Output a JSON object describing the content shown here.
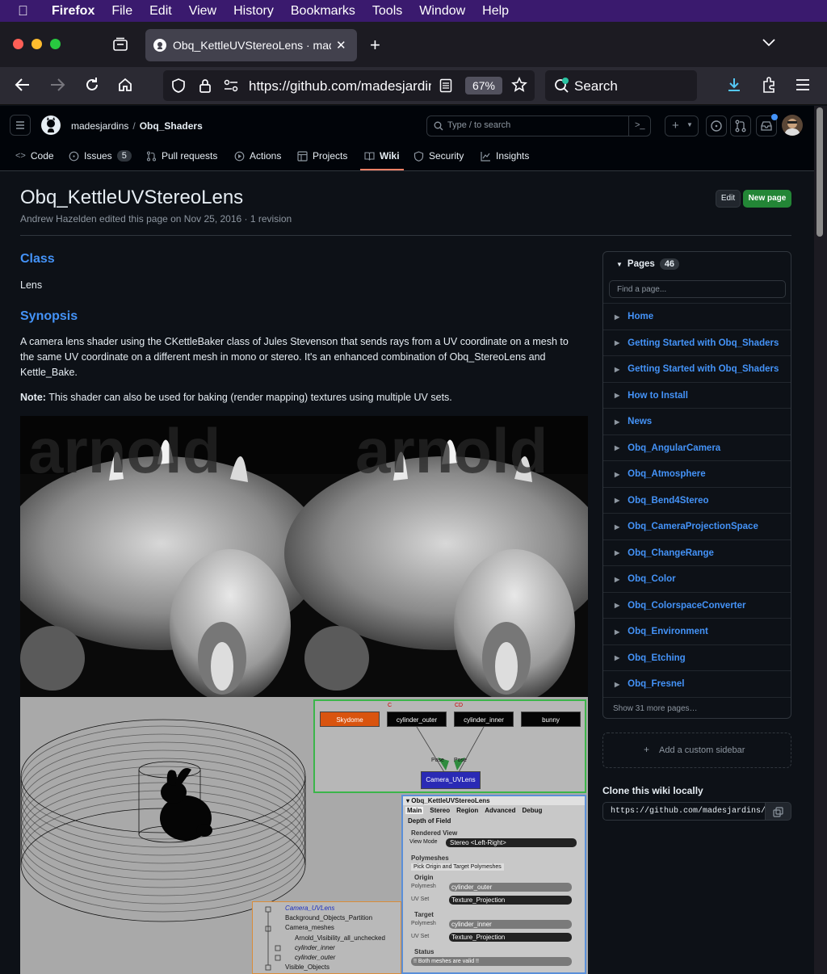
{
  "menubar": {
    "app": "Firefox",
    "items": [
      "File",
      "Edit",
      "View",
      "History",
      "Bookmarks",
      "Tools",
      "Window",
      "Help"
    ]
  },
  "browser": {
    "tab_title": "Obq_KettleUVStereoLens · madesjardins/Obq_Shaders Wiki",
    "url": "https://github.com/madesjardins/Obq_Shaders/wiki/Obq_KettleUVStereoLens",
    "zoom": "67%",
    "search_label": "Search"
  },
  "github": {
    "owner": "madesjardins",
    "sep": "/",
    "repo": "Obq_Shaders",
    "search_placeholder": "Type / to search",
    "tabs": [
      {
        "label": "Code",
        "icon": "code-icon"
      },
      {
        "label": "Issues",
        "count": "5",
        "icon": "issue-icon"
      },
      {
        "label": "Pull requests",
        "icon": "pull-request-icon"
      },
      {
        "label": "Actions",
        "icon": "play-icon"
      },
      {
        "label": "Projects",
        "icon": "table-icon"
      },
      {
        "label": "Wiki",
        "icon": "book-icon",
        "active": true
      },
      {
        "label": "Security",
        "icon": "shield-icon"
      },
      {
        "label": "Insights",
        "icon": "graph-icon"
      }
    ],
    "accent": "#4493f8",
    "active_underline": "#f78166"
  },
  "page": {
    "title": "Obq_KettleUVStereoLens",
    "meta": "Andrew Hazelden edited this page on Nov 25, 2016 · 1 revision",
    "edit_label": "Edit",
    "new_page_label": "New page",
    "class_heading": "Class",
    "class_value": "Lens",
    "synopsis_heading": "Synopsis",
    "synopsis": "A camera lens shader using the CKettleBaker class of Jules Stevenson that sends rays from a UV coordinate on a mesh to the same UV coordinate on a different mesh in mono or stereo. It's an enhanced combination of Obq_StereoLens and Kettle_Bake.",
    "note_label": "Note:",
    "note": " This shader can also be used for baking (render mapping) textures using multiple UV sets."
  },
  "sidebar": {
    "pages_label": "Pages",
    "pages_count": "46",
    "find_placeholder": "Find a page...",
    "items": [
      "Home",
      "Getting Started with Obq_Shaders",
      "Getting Started with Obq_Shaders",
      "How to Install",
      "News",
      "Obq_AngularCamera",
      "Obq_Atmosphere",
      "Obq_Bend4Stereo",
      "Obq_CameraProjectionSpace",
      "Obq_ChangeRange",
      "Obq_Color",
      "Obq_ColorspaceConverter",
      "Obq_Environment",
      "Obq_Etching",
      "Obq_Fresnel"
    ],
    "show_more": "Show 31 more pages…",
    "add_sidebar": "Add a custom sidebar",
    "clone_heading": "Clone this wiki locally",
    "clone_url": "https://github.com/madesjardins/Obq_Shaders.wiki.git"
  },
  "figure": {
    "render_watermark": "arnold",
    "nodes": {
      "skydome": "Skydome",
      "cyl_outer": "cylinder_outer",
      "cyl_inner": "cylinder_inner",
      "bunny": "bunny",
      "camera": "Camera_UVLens",
      "pose1": "Pose",
      "pose2": "Pose",
      "mark_c": "C",
      "mark_cd": "CD"
    },
    "ppg": {
      "title": "Obq_KettleUVStereoLens",
      "tabs": [
        "Main",
        "Stereo",
        "Region",
        "Advanced",
        "Debug"
      ],
      "dof": "Depth of Field",
      "rendered_view": "Rendered View",
      "view_mode_label": "View Mode",
      "view_mode": "Stereo <Left-Right>",
      "polymeshes": "Polymeshes",
      "pick": "Pick Origin and Target Polymeshes",
      "origin": "Origin",
      "polymesh_label": "Polymesh",
      "origin_mesh": "cylinder_outer",
      "uvset_label": "UV Set",
      "origin_uv": "Texture_Projection",
      "target": "Target",
      "target_mesh": "cylinder_inner",
      "target_uv": "Texture_Projection",
      "status": "Status",
      "status_msg": "!! Both meshes are valid !!"
    },
    "tree": [
      "Camera_UVLens",
      "Background_Objects_Partition",
      "Camera_meshes",
      "Arnold_Visibility_all_unchecked",
      "cylinder_inner",
      "cylinder_outer",
      "Visible_Objects"
    ]
  }
}
